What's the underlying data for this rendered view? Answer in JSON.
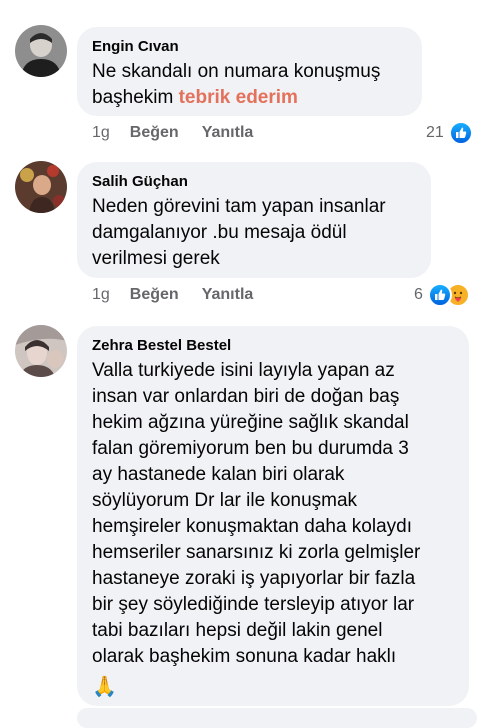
{
  "comments": [
    {
      "author": "Engin Cıvan",
      "lines": [
        "Ne skandalı on numara konuşmuş"
      ],
      "last_line_prefix": "başhekim ",
      "last_line_highlight": "tebrik ederim",
      "time": "1g",
      "like_label": "Beğen",
      "reply_label": "Yanıtla",
      "reaction_count": "21",
      "reactions": [
        "like-icon"
      ]
    },
    {
      "author": "Salih Güçhan",
      "lines": [
        "Neden görevini tam yapan insanlar",
        "damgalanıyor .bu mesaja ödül",
        "verilmesi gerek"
      ],
      "time": "1g",
      "like_label": "Beğen",
      "reply_label": "Yanıtla",
      "reaction_count": "6",
      "reactions": [
        "like-icon",
        "care-icon"
      ]
    },
    {
      "author": "Zehra Bestel Bestel",
      "lines": [
        "Valla turkiyede isini layıyla yapan az",
        "insan var onlardan biri de doğan baş",
        "hekim ağzına yüreğine sağlık skandal",
        "falan göremiyorum ben bu durumda 3",
        "ay hastanede kalan biri olarak",
        "söylüyorum Dr lar ile konuşmak",
        "hemşireler konuşmaktan daha kolaydı",
        "hemseriler sanarsınız ki zorla gelmişler",
        "hastaneye zoraki iş yapıyorlar bir fazla",
        "bir şey söylediğinde tersleyip atıyor lar",
        "tabi bazıları hepsi değil lakin genel",
        "olarak başhekim sonuna kadar haklı"
      ],
      "emoji": "🙏"
    }
  ],
  "colors": {
    "bubble_bg": "#f0f2f5",
    "secondary_text": "#65676b",
    "highlight": "#e4715b",
    "like_blue": "#1877f2"
  }
}
